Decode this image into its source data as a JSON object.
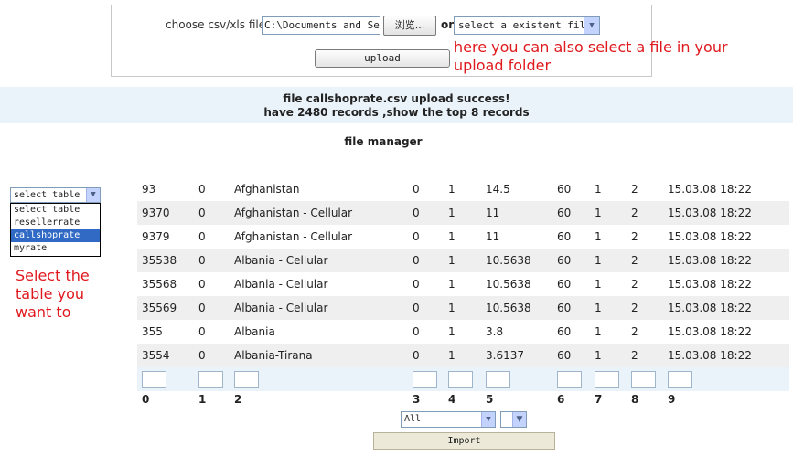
{
  "upload": {
    "choose_label": "choose csv/xls file:",
    "file_path_value": "C:\\Documents and Sett",
    "browse_label": "浏览...",
    "or_label": "or",
    "existent_file_select": "select a existent file",
    "upload_button": "upload",
    "annotation": "here you can also select a file in your upload folder"
  },
  "status": {
    "line1": "file callshoprate.csv upload success!",
    "line2": "have 2480 records ,show the top 8 records"
  },
  "file_manager_title": "file manager",
  "table_select": {
    "selected": "select table",
    "options": [
      "select table",
      "resellerrate",
      "callshoprate",
      "myrate"
    ],
    "highlighted": "callshoprate",
    "annotation": "Select the table you want to"
  },
  "grid": {
    "rows": [
      [
        "93",
        "0",
        "Afghanistan",
        "0",
        "1",
        "14.5",
        "60",
        "1",
        "2",
        "15.03.08 18:22"
      ],
      [
        "9370",
        "0",
        "Afghanistan - Cellular",
        "0",
        "1",
        "11",
        "60",
        "1",
        "2",
        "15.03.08 18:22"
      ],
      [
        "9379",
        "0",
        "Afghanistan - Cellular",
        "0",
        "1",
        "11",
        "60",
        "1",
        "2",
        "15.03.08 18:22"
      ],
      [
        "35538",
        "0",
        "Albania - Cellular",
        "0",
        "1",
        "10.5638",
        "60",
        "1",
        "2",
        "15.03.08 18:22"
      ],
      [
        "35568",
        "0",
        "Albania - Cellular",
        "0",
        "1",
        "10.5638",
        "60",
        "1",
        "2",
        "15.03.08 18:22"
      ],
      [
        "35569",
        "0",
        "Albania - Cellular",
        "0",
        "1",
        "10.5638",
        "60",
        "1",
        "2",
        "15.03.08 18:22"
      ],
      [
        "355",
        "0",
        "Albania",
        "0",
        "1",
        "3.8",
        "60",
        "1",
        "2",
        "15.03.08 18:22"
      ],
      [
        "3554",
        "0",
        "Albania-Tirana",
        "0",
        "1",
        "3.6137",
        "60",
        "1",
        "2",
        "15.03.08 18:22"
      ]
    ],
    "column_indexes": [
      "0",
      "1",
      "2",
      "3",
      "4",
      "5",
      "6",
      "7",
      "8",
      "9"
    ]
  },
  "import": {
    "encoding_select": "All",
    "separator_select": "",
    "import_button": "Import"
  },
  "colors": {
    "annotation": "#e0191e",
    "band": "#eaf2fa",
    "row_alt": "#efefef",
    "option_highlight": "#316ac5"
  }
}
